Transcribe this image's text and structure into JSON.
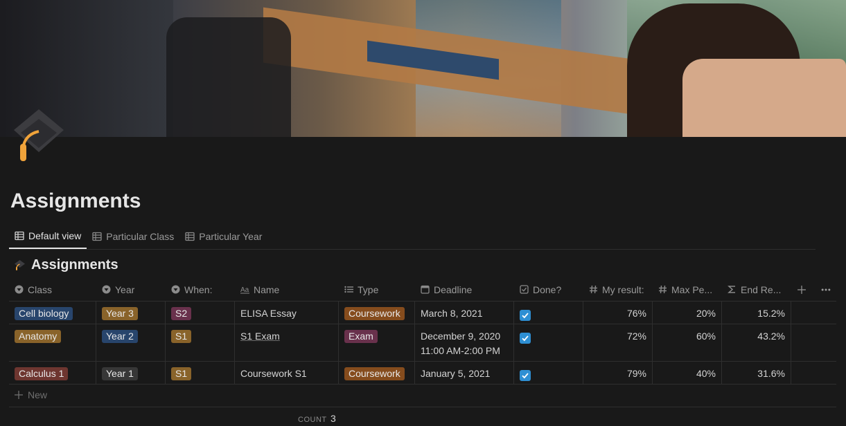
{
  "page": {
    "title": "Assignments"
  },
  "tabs": [
    {
      "label": "Default view"
    },
    {
      "label": "Particular Class"
    },
    {
      "label": "Particular Year"
    }
  ],
  "database": {
    "title": "Assignments"
  },
  "columns": {
    "class": "Class",
    "year": "Year",
    "when": "When:",
    "name": "Name",
    "type": "Type",
    "deadline": "Deadline",
    "done": "Done?",
    "my_result": "My result:",
    "max_pe": "Max Pe...",
    "end_re": "End Re..."
  },
  "rows": [
    {
      "class": "Cell biology",
      "year": "Year 3",
      "when": "S2",
      "name": "ELISA Essay",
      "type": "Coursework",
      "deadline": "March 8, 2021",
      "deadline_time": "",
      "done": true,
      "my_result": "76%",
      "max_pe": "20%",
      "end_re": "15.2%"
    },
    {
      "class": "Anatomy",
      "year": "Year 2",
      "when": "S1",
      "name": "S1 Exam",
      "type": "Exam",
      "deadline": "December 9, 2020",
      "deadline_time": "11:00 AM-2:00 PM",
      "done": true,
      "my_result": "72%",
      "max_pe": "60%",
      "end_re": "43.2%"
    },
    {
      "class": "Calculus 1",
      "year": "Year 1",
      "when": "S1",
      "name": "Coursework S1",
      "type": "Coursework",
      "deadline": "January 5, 2021",
      "deadline_time": "",
      "done": true,
      "my_result": "79%",
      "max_pe": "40%",
      "end_re": "31.6%"
    }
  ],
  "footer": {
    "new_label": "New",
    "count_label": "COUNT",
    "count_value": "3"
  },
  "colors": {
    "background": "#191919",
    "tag_blue": "#28456c",
    "tag_orange": "#89632a",
    "tag_red": "#6e3630",
    "tag_gray": "#373737",
    "tag_pink": "#69314c",
    "tag_brown": "#854c1d",
    "check_blue": "#2e8fd3"
  }
}
